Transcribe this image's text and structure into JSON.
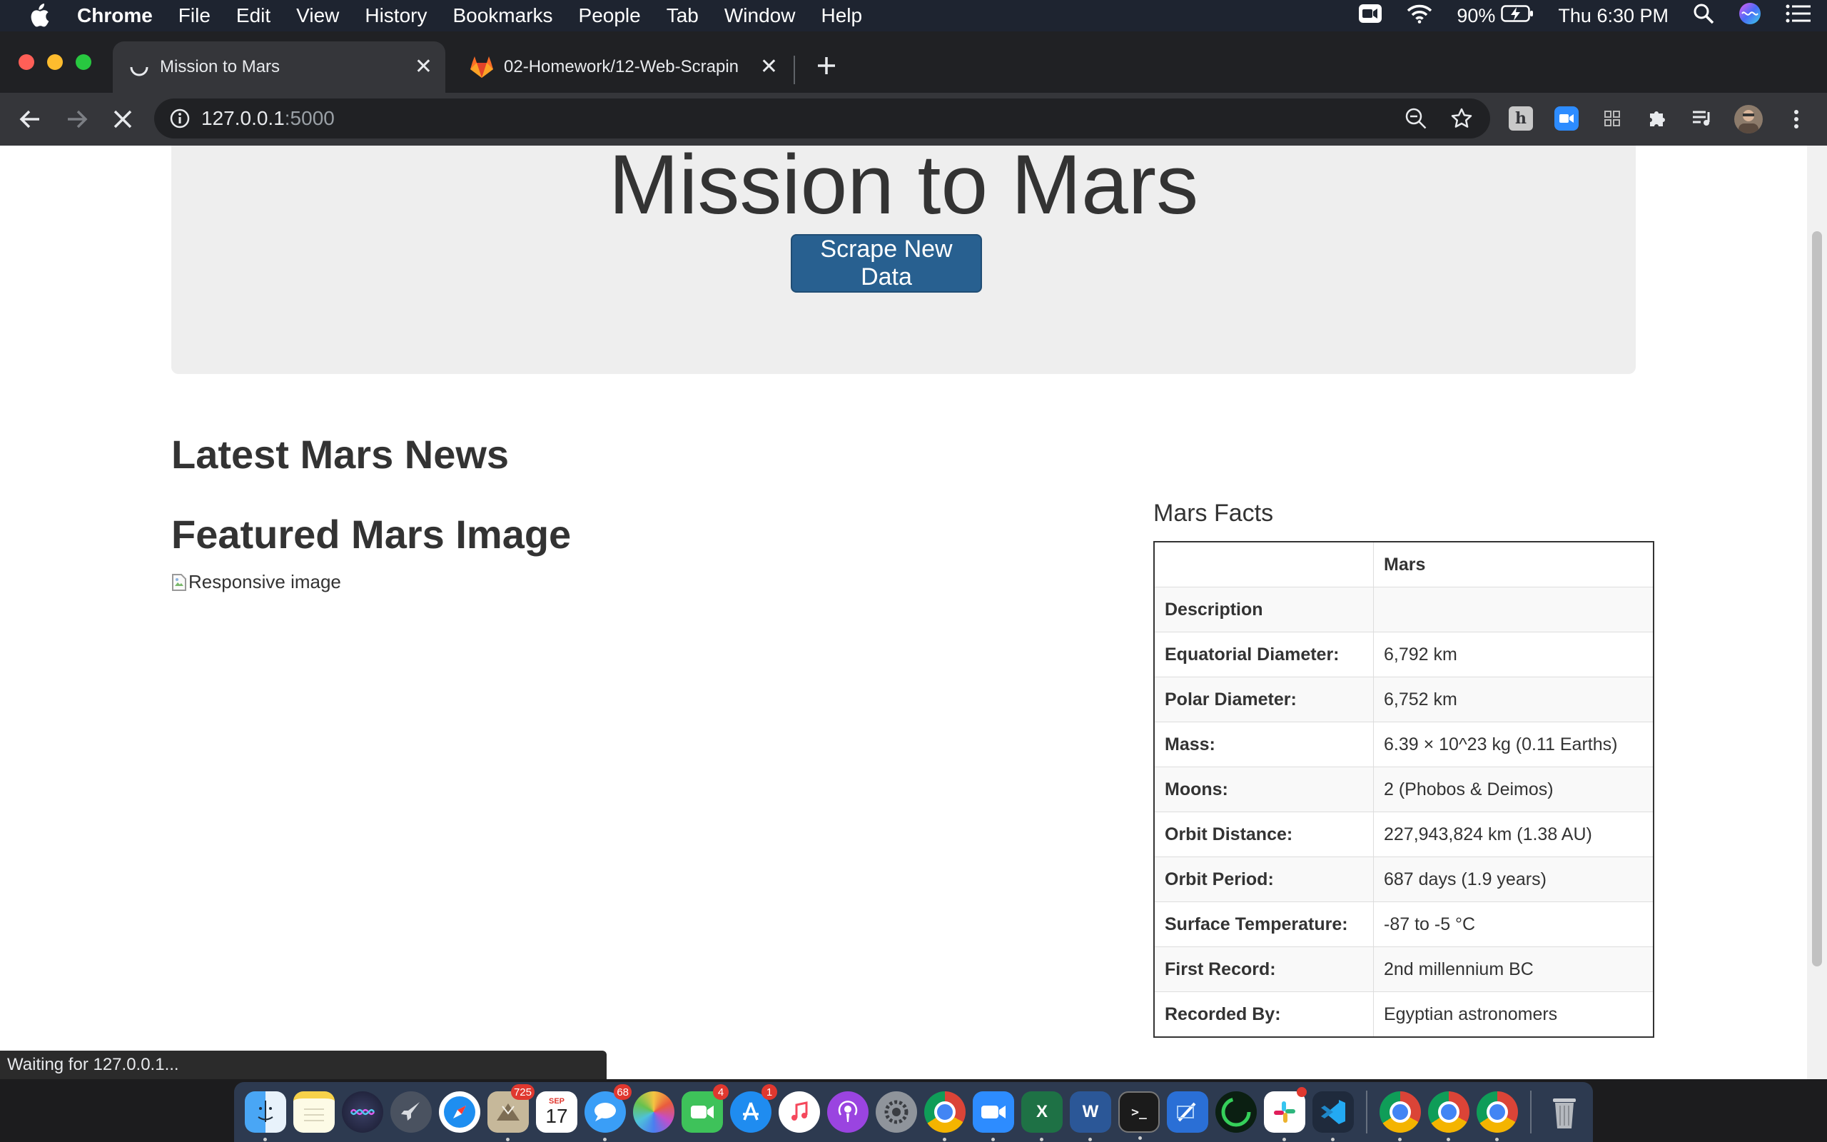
{
  "menubar": {
    "app_name": "Chrome",
    "items": [
      "File",
      "Edit",
      "View",
      "History",
      "Bookmarks",
      "People",
      "Tab",
      "Window",
      "Help"
    ],
    "battery": "90%",
    "clock": "Thu 6:30 PM"
  },
  "browser": {
    "tabs": [
      {
        "title": "Mission to Mars",
        "active": true,
        "loading": true
      },
      {
        "title": "02-Homework/12-Web-Scrapin",
        "active": false
      }
    ],
    "url_host": "127.0.0.1",
    "url_port": ":5000",
    "status_text": "Waiting for 127.0.0.1..."
  },
  "page": {
    "title": "Mission to Mars",
    "scrape_button": "Scrape New Data",
    "news_heading": "Latest Mars News",
    "image_heading": "Featured Mars Image",
    "image_alt": "Responsive image",
    "facts_heading": "Mars Facts",
    "facts_table": {
      "header": [
        "",
        "Mars"
      ],
      "rows": [
        {
          "label": "Description",
          "value": ""
        },
        {
          "label": "Equatorial Diameter:",
          "value": "6,792 km"
        },
        {
          "label": "Polar Diameter:",
          "value": "6,752 km"
        },
        {
          "label": "Mass:",
          "value": "6.39 × 10^23 kg (0.11 Earths)"
        },
        {
          "label": "Moons:",
          "value": "2 (Phobos & Deimos)"
        },
        {
          "label": "Orbit Distance:",
          "value": "227,943,824 km (1.38 AU)"
        },
        {
          "label": "Orbit Period:",
          "value": "687 days (1.9 years)"
        },
        {
          "label": "Surface Temperature:",
          "value": "-87 to -5 °C"
        },
        {
          "label": "First Record:",
          "value": "2nd millennium BC"
        },
        {
          "label": "Recorded By:",
          "value": "Egyptian astronomers"
        }
      ]
    }
  },
  "dock": {
    "badges": {
      "mail": "725",
      "calendar_month": "SEP",
      "calendar_day": "17",
      "messages": "68",
      "facetime": "4",
      "appstore": "1"
    }
  },
  "colors": {
    "menubar": "#1e2430",
    "button": "#286090",
    "jumbotron": "#eeeeee"
  }
}
